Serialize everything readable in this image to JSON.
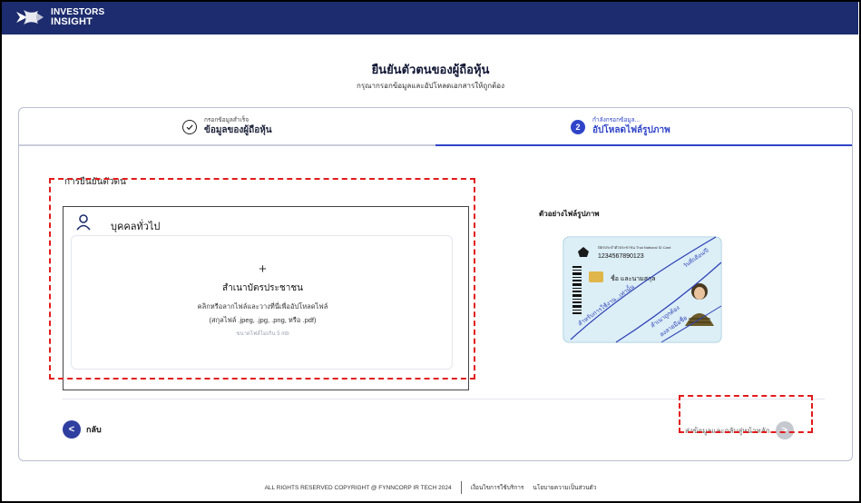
{
  "brand": {
    "line1": "INVESTORS",
    "line2": "INSIGHT",
    "color": "#1d2c6e"
  },
  "header": {
    "title": "ยืนยันตัวตนของผู้ถือหุ้น",
    "subtitle": "กรุณากรอกข้อมูลและอัปโหลดเอกสารให้ถูกต้อง"
  },
  "steps": [
    {
      "number": "1",
      "status": "กรอกข้อมูลสำเร็จ",
      "label": "ข้อมูลของผู้ถือหุ้น",
      "state": "done"
    },
    {
      "number": "2",
      "status": "กำลังกรอกข้อมูล...",
      "label": "อัปโหลดไฟล์รูปภาพ",
      "state": "active"
    }
  ],
  "section_label": "การยืนยันตัวตน",
  "upload": {
    "person_type": "บุคคลทั่วไป",
    "plus": "+",
    "title": "สำเนาบัตรประชาชน",
    "instruction": "คลิกหรือลากไฟล์และวางที่นี่เพื่ออัปโหลดไฟล์",
    "formats": "(สกุลไฟล์ .jpeg, .jpg, .png, หรือ .pdf)",
    "size_limit": "ขนาดไฟล์ไม่เกิน 5 mb"
  },
  "sample": {
    "title": "ตัวอย่างไฟล์รูปภาพ",
    "card_header": "บัตรประจำตัวประชาชน Thai National ID Card",
    "id_number": "1234567890123",
    "name_text": "ชื่อ และนามสกุล",
    "watermark": "สำหรับการใช้งาน...เท่านั้น",
    "stamp_1": "สำเนาถูกต้อง",
    "stamp_2": "ลงลายมือชื่อ",
    "date_text": "วันที่/เดือน/ปี"
  },
  "nav": {
    "back_label": "กลับ",
    "back_icon": "<",
    "next_label": "ส่งข้อมูลและกลับสู่หน้าหลัก",
    "next_icon": ">"
  },
  "footer": {
    "copyright": "ALL RIGHTS RESERVED COPYRIGHT @ FYNNCORP IR TECH 2024",
    "terms": "เงื่อนไขการใช้บริการ",
    "privacy": "นโยบายความเป็นส่วนตัว"
  },
  "colors": {
    "accent": "#2f44c8",
    "navy": "#1d2c6e",
    "highlight_dash": "#e21b1b",
    "disabled": "#c6c8cf"
  }
}
